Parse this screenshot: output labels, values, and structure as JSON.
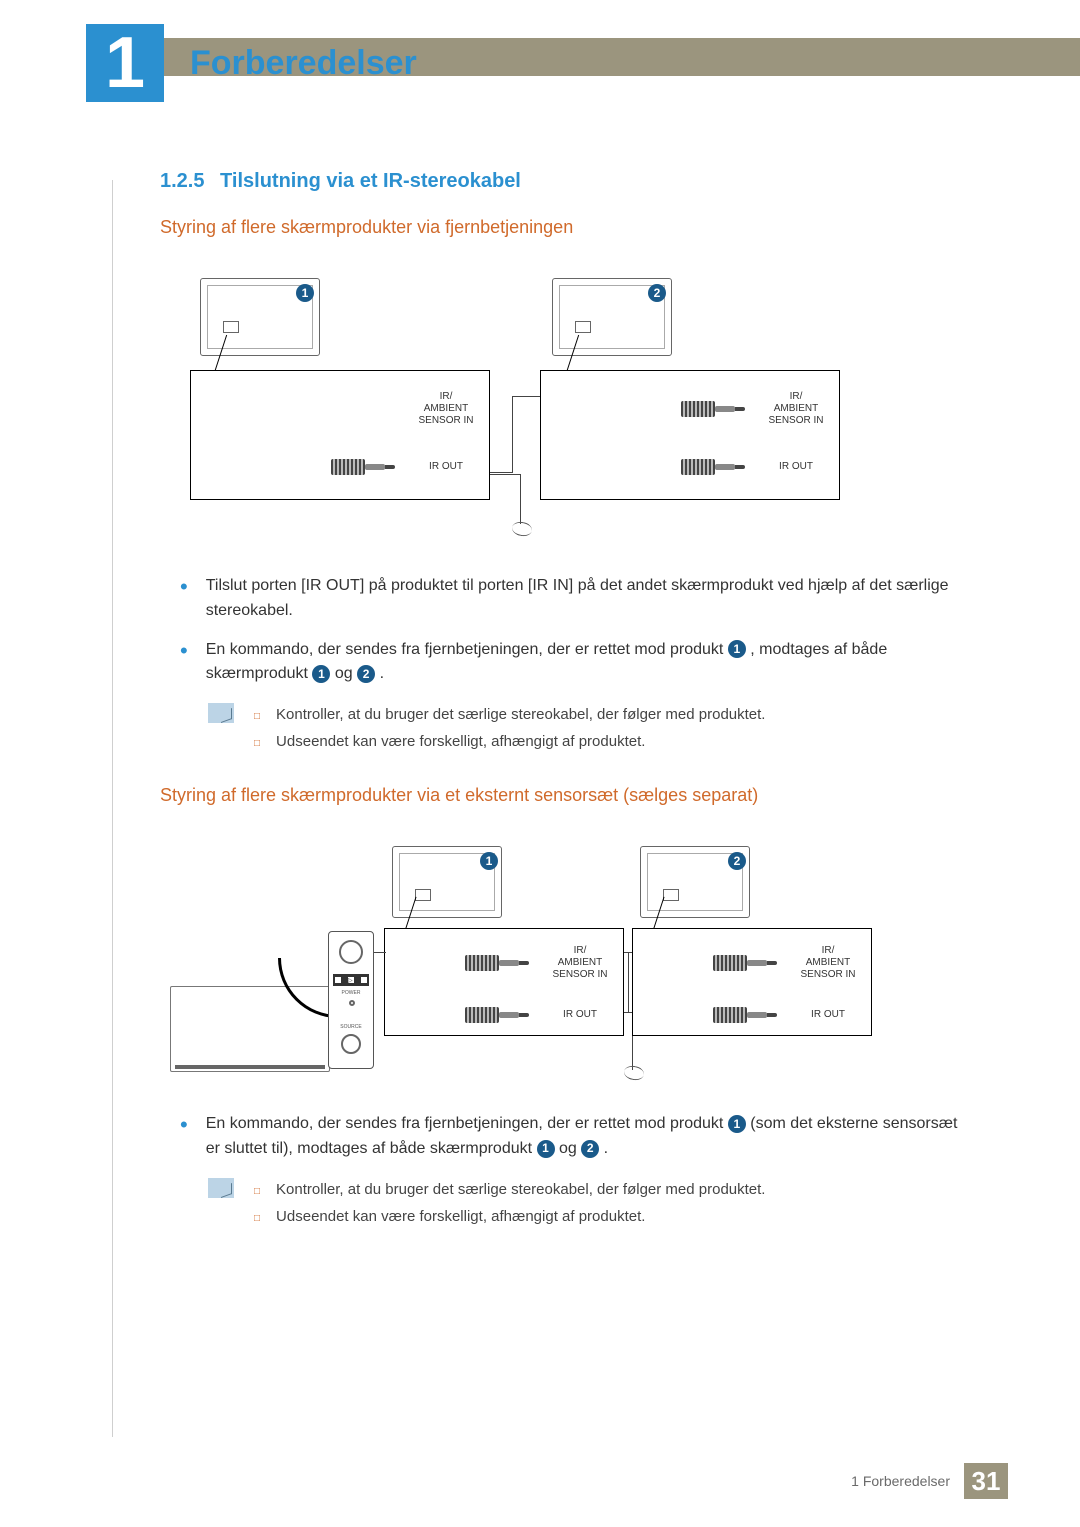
{
  "header": {
    "chapter_number": "1",
    "chapter_title": "Forberedelser"
  },
  "section": {
    "number": "1.2.5",
    "title": "Tilslutning via et IR-stereokabel"
  },
  "sub1": {
    "title": "Styring af flere skærmprodukter via fjernbetjeningen",
    "diagram": {
      "badge1": "1",
      "badge2": "2",
      "label_ir_in": "IR/\nAMBIENT\nSENSOR IN",
      "label_ir_out": "IR OUT"
    },
    "bullets": [
      "Tilslut porten [IR OUT] på produktet til porten [IR IN] på det andet skærmprodukt ved hjælp af det særlige stereokabel."
    ],
    "bullet2_parts": {
      "a": "En kommando, der sendes fra fjernbetjeningen, der er rettet mod produkt ",
      "b": " , modtages af både skærmprodukt ",
      "c": "  og  ",
      "d": " ."
    },
    "notes": [
      "Kontroller, at du bruger det særlige stereokabel, der følger med produktet.",
      "Udseendet kan være forskelligt, afhængigt af produktet."
    ]
  },
  "sub2": {
    "title": "Styring af flere skærmprodukter via et eksternt sensorsæt (sælges separat)",
    "diagram": {
      "badge1": "1",
      "badge2": "2",
      "label_ir_in": "IR/\nAMBIENT\nSENSOR IN",
      "label_ir_out": "IR OUT",
      "remote_power": "POWER",
      "remote_source": "SOURCE"
    },
    "bullet_parts": {
      "a": "En kommando, der sendes fra fjernbetjeningen, der er rettet mod produkt ",
      "b": "  (som det eksterne sensorsæt er sluttet til), modtages af både skærmprodukt ",
      "c": "  og  ",
      "d": " ."
    },
    "notes": [
      "Kontroller, at du bruger det særlige stereokabel, der følger med produktet.",
      "Udseendet kan være forskelligt, afhængigt af produktet."
    ]
  },
  "footer": {
    "text": "1 Forberedelser",
    "page": "31"
  }
}
